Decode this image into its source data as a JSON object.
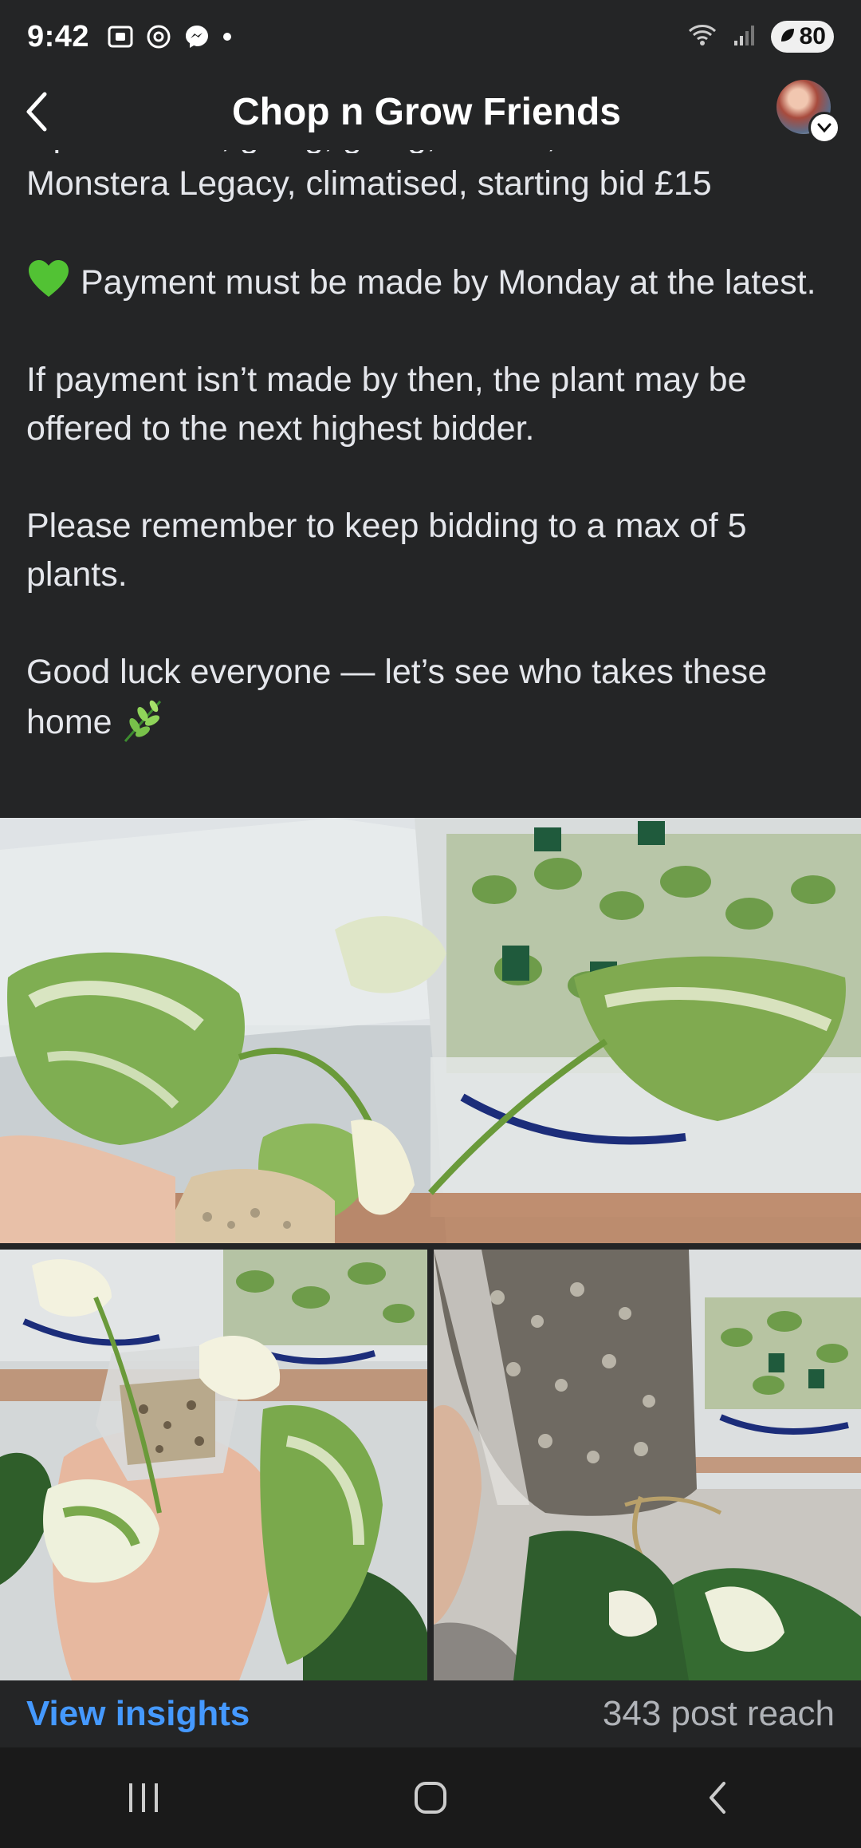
{
  "status_bar": {
    "time": "9:42",
    "icons_left": [
      "screenshot-icon",
      "threads-icon",
      "messenger-icon",
      "dot-icon"
    ],
    "icons_right": [
      "wifi-icon",
      "signal-icon"
    ],
    "battery": "80"
  },
  "header": {
    "back": "back",
    "title": "Chop n Grow Friends"
  },
  "post": {
    "cut_line": "Open to bids, going, going, GONE,",
    "line1": "Monstera Legacy, climatised, starting bid £15",
    "payment": "Payment must be made by Monday at the latest.",
    "payment_note": "If payment isn’t made by then, the plant may be offered to the next highest bidder.",
    "reminder": "Please remember to keep bidding to a max of 5 plants.",
    "closing": "Good luck everyone — let’s see who takes these home"
  },
  "photos": {
    "top_alt": "",
    "bottom_left_alt": "",
    "bottom_right_alt": ""
  },
  "footer": {
    "view_insights": "View insights",
    "post_reach": "343 post reach"
  },
  "colors": {
    "background": "#242526",
    "link": "#4599ff",
    "muted": "#b0b3b8"
  }
}
